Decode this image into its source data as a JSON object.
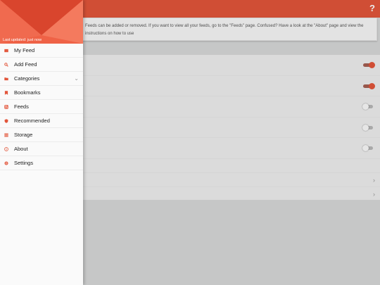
{
  "app": {
    "help_label": "?",
    "notice_text": "Feeds can be added or removed. If you want to view all your feeds, go to the \"Feeds\" page. Confused? Have a look at the \"About\" page and view the instructions on how to use",
    "colors": {
      "accent": "#e2553a",
      "header": "#ef6246",
      "background": "#d7d8d8"
    }
  },
  "settings": {
    "toggles": [
      {
        "state": "on"
      },
      {
        "state": "on"
      },
      {
        "state": "off"
      },
      {
        "state": "off"
      },
      {
        "state": "off"
      }
    ]
  },
  "drawer": {
    "last_updated": "Last updated: just now",
    "items": [
      {
        "label": "My Feed",
        "icon": "inbox-icon"
      },
      {
        "label": "Add Feed",
        "icon": "search-icon"
      },
      {
        "label": "Categories",
        "icon": "folder-icon",
        "expandable": true
      },
      {
        "label": "Bookmarks",
        "icon": "bookmark-icon"
      },
      {
        "label": "Feeds",
        "icon": "rss-icon"
      },
      {
        "label": "Recommended",
        "icon": "shield-icon"
      },
      {
        "label": "Storage",
        "icon": "storage-icon"
      },
      {
        "label": "About",
        "icon": "info-icon"
      },
      {
        "label": "Settings",
        "icon": "gear-icon"
      }
    ]
  }
}
